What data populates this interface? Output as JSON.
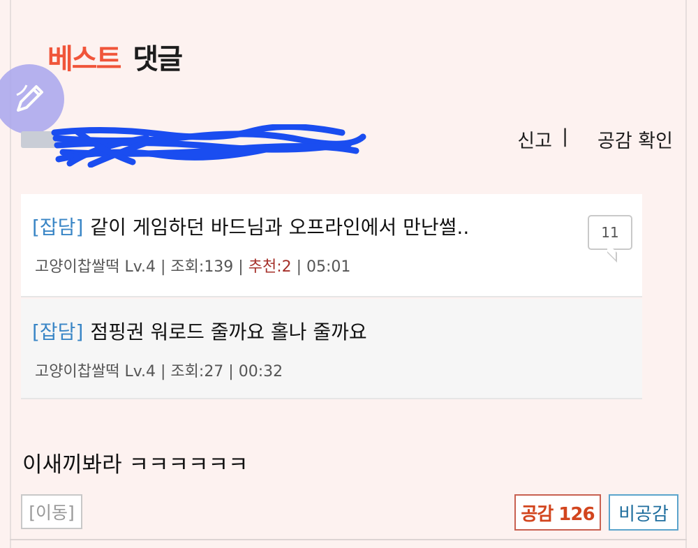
{
  "header": {
    "best_label": "베스트",
    "comment_label": "댓글"
  },
  "comment": {
    "actions": {
      "report": "신고",
      "separator": "|",
      "likes_check": "공감 확인"
    },
    "body": "이새끼봐라 ㅋㅋㅋㅋㅋㅋ",
    "footer": {
      "move": "[이동]",
      "like": "공감 126",
      "dislike": "비공감"
    }
  },
  "posts": [
    {
      "category": "[잡담]",
      "title": "같이 게임하던 바드님과 오프라인에서 만난썰..",
      "author": "고양이찹쌀떡",
      "level": "Lv.4",
      "views": "조회:139",
      "recommend": "추천:2",
      "time": "05:01",
      "reply_count": "11"
    },
    {
      "category": "[잡담]",
      "title": "점핑권 워로드 줄까요 홀나 줄까요",
      "author": "고양이찹쌀떡",
      "level": "Lv.4",
      "views": "조회:27",
      "time": "00:32"
    }
  ],
  "colors": {
    "best_red": "#f0553a",
    "category_blue": "#3a86c6",
    "recommend_red": "#a5302a",
    "like_orange": "#d2451e",
    "dislike_blue": "#1f6e9e",
    "fab_purple": "#a9a6ee",
    "redaction_blue": "#1a4df0"
  },
  "icons": {
    "fab": "pencil-icon",
    "reply": "speech-bubble-icon"
  }
}
